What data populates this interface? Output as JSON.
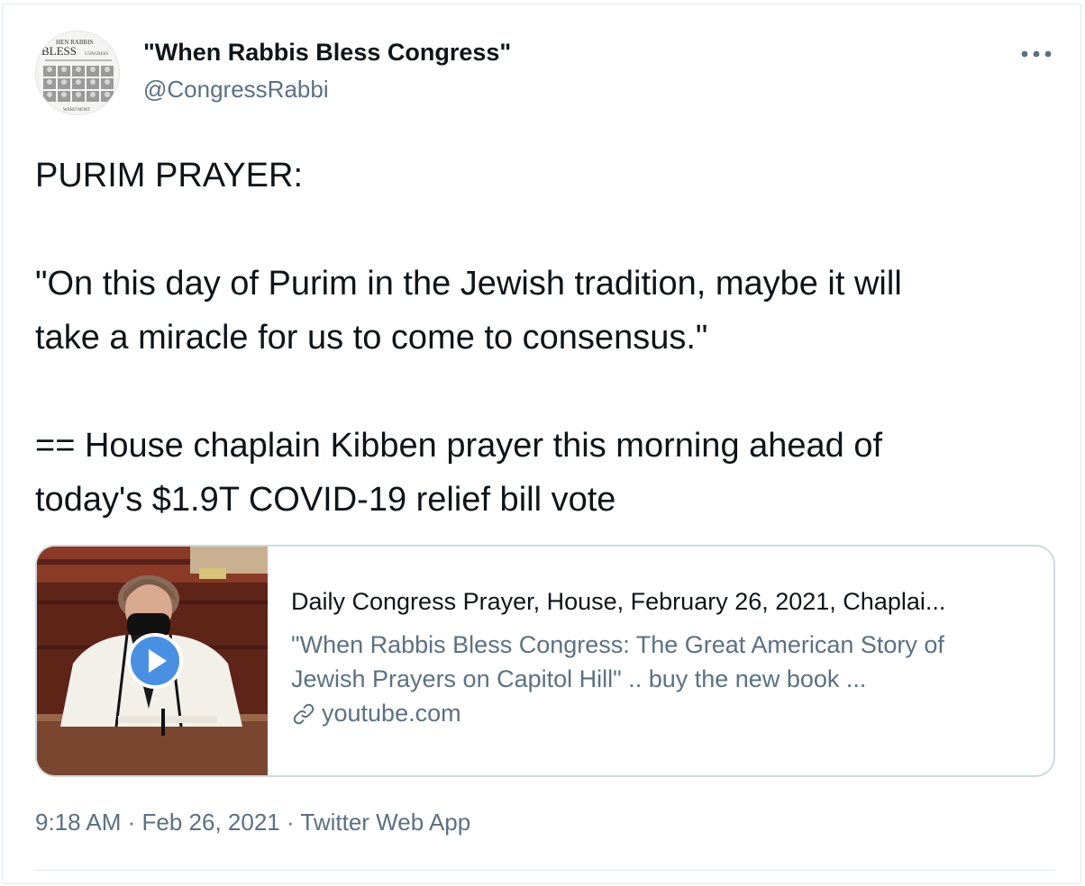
{
  "author": {
    "display_name": "\"When Rabbis Bless Congress\"",
    "handle": "@CongressRabbi",
    "avatar_icon": "book-cover-avatar",
    "avatar_text": {
      "line1": "HEN RABBIS",
      "line2": "BLESS",
      "line3": "CONGRESS",
      "footer": "WARD MORT"
    }
  },
  "more_icon": "more-horizontal-icon",
  "tweet": {
    "lines": [
      "PURIM PRAYER:",
      "",
      "\"On this day of Purim in the Jewish tradition, maybe it will",
      "take a miracle for us to come to consensus.\"",
      "",
      "== House chaplain Kibben prayer this morning ahead of",
      "today's $1.9T COVID-19 relief bill vote"
    ]
  },
  "card": {
    "title": "Daily Congress Prayer, House, February 26, 2021, Chaplai...",
    "description_lines": [
      "\"When Rabbis Bless Congress: The Great American Story of",
      "Jewish Prayers on Capitol Hill\" .. buy the new book ..."
    ],
    "domain": "youtube.com",
    "link_icon": "link-icon",
    "play_icon": "play-button-icon"
  },
  "meta": {
    "time": "9:18 AM",
    "separator": " · ",
    "date": "Feb 26, 2021",
    "source": "Twitter Web App"
  },
  "colors": {
    "text_primary": "#0f1419",
    "text_secondary": "#5b7083",
    "border": "#cfd9de",
    "play_blue": "#4a90e2"
  }
}
